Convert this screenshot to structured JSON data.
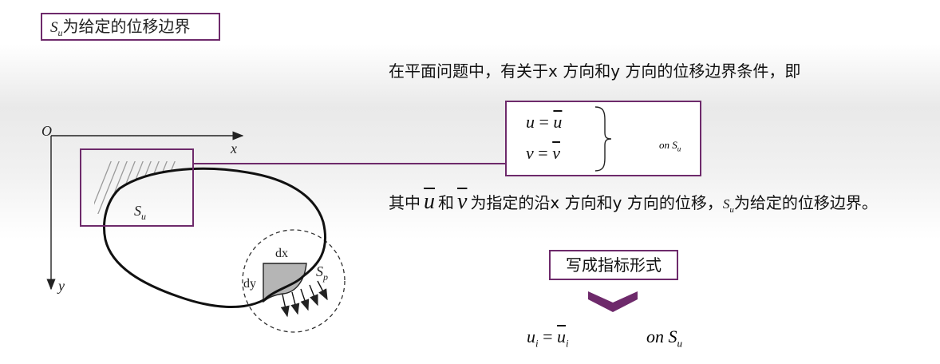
{
  "title_box": {
    "symbol": "S",
    "symbol_sub": "u",
    "text": "为给定的位移边界"
  },
  "intro_text": "在平面问题中，有关于x 方向和y 方向的位移边界条件，即",
  "eq_box": {
    "line1_lhs": "u",
    "line1_eq": " = ",
    "line1_rhs": "u",
    "line2_lhs": "v",
    "line2_eq": " = ",
    "line2_rhs": "v",
    "on_text": "on ",
    "on_symbol": "S",
    "on_sub": "u"
  },
  "explain": {
    "p1": "其中",
    "u_sym": "u",
    "p2": "和",
    "v_sym": "v",
    "p3": "为指定的沿x 方向和y 方向的位移，",
    "s_sym": "S",
    "s_sub": "u",
    "p4": "为给定的位移边界。"
  },
  "step_label": "写成指标形式",
  "index_form": {
    "lhs": "u",
    "lhs_sub": "i",
    "eq": " = ",
    "rhs": "u",
    "rhs_sub": "i",
    "on_text": "on  ",
    "on_symbol": "S",
    "on_sub": "u"
  },
  "figure": {
    "origin": "O",
    "x_axis": "x",
    "y_axis": "y",
    "su_label": "S",
    "su_sub": "u",
    "sp_label": "S",
    "sp_sub": "p",
    "dx_label": "dx",
    "dy_label": "dy"
  },
  "colors": {
    "box_border": "#6e2a6b",
    "chevron": "#6e2a6b",
    "shading": "#b5b5b5"
  }
}
